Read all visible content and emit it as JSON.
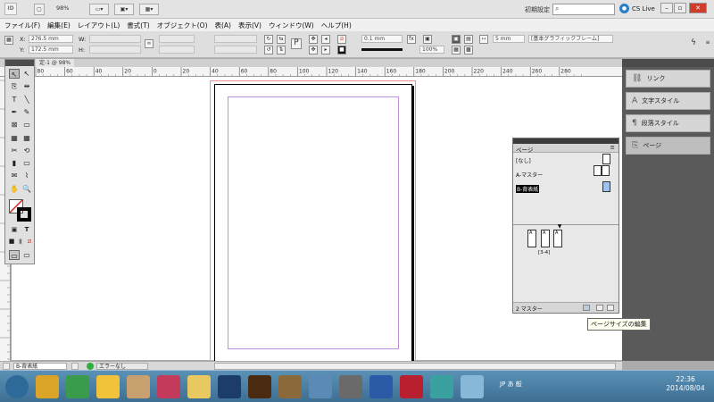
{
  "appbar": {
    "logo": "ID",
    "zoom": "98%",
    "preset": "初期設定",
    "search_placeholder": "",
    "cslive": "CS Live",
    "cslive_icon": "globe-icon"
  },
  "menu": [
    "ファイル(F)",
    "編集(E)",
    "レイアウト(L)",
    "書式(T)",
    "オブジェクト(O)",
    "表(A)",
    "表示(V)",
    "ウィンドウ(W)",
    "ヘルプ(H)"
  ],
  "control": {
    "x_label": "X:",
    "x_value": "276.5 mm",
    "y_label": "Y:",
    "y_value": "172.5 mm",
    "w_label": "W:",
    "h_label": "H:",
    "stroke_weight": "0.1 mm",
    "opacity": "100%",
    "spacing": "5 mm",
    "frame_style": "[基本グラフィックフレーム]"
  },
  "document_tab": "定-1 @ 98%",
  "ruler_labels": [
    "80",
    "60",
    "40",
    "20",
    "0",
    "20",
    "40",
    "60",
    "80",
    "100",
    "120",
    "140",
    "160",
    "180",
    "200",
    "220",
    "240",
    "260",
    "280"
  ],
  "dock": [
    {
      "label": "リンク",
      "icon": "link-icon"
    },
    {
      "label": "文字スタイル",
      "icon": "character-style-icon"
    },
    {
      "label": "段落スタイル",
      "icon": "paragraph-style-icon"
    },
    {
      "label": "ページ",
      "icon": "pages-icon"
    }
  ],
  "pages_panel": {
    "title": "ページ",
    "masters": [
      "[なし]",
      "A-マスター",
      "B-背表紙"
    ],
    "spread_label": "[3-4]",
    "footer": "2 マスター",
    "page_letters": [
      "A",
      "A",
      "A"
    ]
  },
  "tooltip": "ページサイズの編集",
  "status": {
    "page": "B-背表紙",
    "errors": "エラーなし"
  },
  "tools": [
    {
      "name": "selection-tool",
      "glyph": "↖"
    },
    {
      "name": "direct-selection-tool",
      "glyph": "↖"
    },
    {
      "name": "page-tool",
      "glyph": "⎘"
    },
    {
      "name": "gap-tool",
      "glyph": "⇹"
    },
    {
      "name": "type-tool",
      "glyph": "T"
    },
    {
      "name": "line-tool",
      "glyph": "╲"
    },
    {
      "name": "pen-tool",
      "glyph": "✒"
    },
    {
      "name": "pencil-tool",
      "glyph": "✎"
    },
    {
      "name": "rectangle-frame-tool",
      "glyph": "⊠"
    },
    {
      "name": "rectangle-tool",
      "glyph": "▭"
    },
    {
      "name": "table-tool",
      "glyph": "▦"
    },
    {
      "name": "grid-tool",
      "glyph": "▦"
    },
    {
      "name": "scissors-tool",
      "glyph": "✂"
    },
    {
      "name": "free-transform-tool",
      "glyph": "⟲"
    },
    {
      "name": "gradient-swatch-tool",
      "glyph": "▮"
    },
    {
      "name": "gradient-feather-tool",
      "glyph": "▭"
    },
    {
      "name": "note-tool",
      "glyph": "✉"
    },
    {
      "name": "eyedropper-tool",
      "glyph": "⌇"
    },
    {
      "name": "hand-tool",
      "glyph": "✋"
    },
    {
      "name": "zoom-tool",
      "glyph": "🔍"
    }
  ],
  "taskbar_apps": [
    "start-orb-icon",
    "explorer-icon",
    "chrome-icon",
    "image-viewer-icon",
    "game-icon",
    "indesign-icon",
    "folder-icon",
    "photoshop-icon",
    "illustrator-icon",
    "app-icon",
    "network-icon",
    "microphone-icon",
    "word-icon",
    "antivirus-icon",
    "app2-icon",
    "browser-icon"
  ],
  "clock": {
    "time": "22:36",
    "date": "2014/08/04"
  },
  "colors": {
    "accent": "#cf3c2c",
    "page_bg": "#ababab"
  }
}
